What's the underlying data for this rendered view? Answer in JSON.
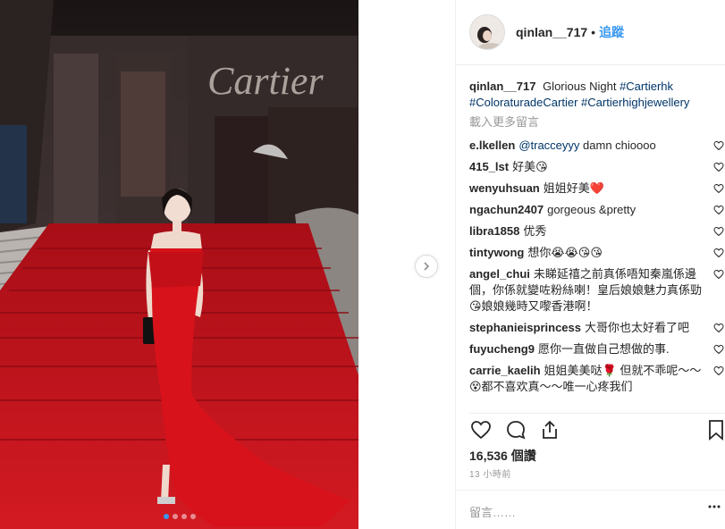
{
  "photo": {
    "sign_text": "Cartier",
    "carousel_total": 4,
    "carousel_active": 1
  },
  "header": {
    "username": "qinlan__717",
    "separator": "•",
    "follow_label": "追蹤"
  },
  "caption": {
    "username": "qinlan__717",
    "text": "Glorious Night",
    "tags": [
      "#Cartierhk",
      "#ColoraturadeCartier",
      "#Cartierhighjewellery"
    ]
  },
  "load_more_label": "載入更多留言",
  "comments": [
    {
      "user": "e.lkellen",
      "mention": "@tracceyyy",
      "text": "damn chioooo"
    },
    {
      "user": "415_lst",
      "text": "好美😘"
    },
    {
      "user": "wenyuhsuan",
      "text": "姐姐好美❤️"
    },
    {
      "user": "ngachun2407",
      "text": "gorgeous &pretty"
    },
    {
      "user": "libra1858",
      "text": "优秀"
    },
    {
      "user": "tintywong",
      "text": "想你😭😭😘😘"
    },
    {
      "user": "angel_chui",
      "text": "未睇延禧之前真係唔知秦嵐係邊個，你係就變咗粉絲喇！皇后娘娘魅力真係勁😘娘娘幾時又嚟香港啊！"
    },
    {
      "user": "stephanieisprincess",
      "text": "大哥你也太好看了吧"
    },
    {
      "user": "fuyucheng9",
      "text": "愿你一直做自己想做的事."
    },
    {
      "user": "carrie_kaelih",
      "text": "姐姐美美哒🌹 但就不乖呢～～😵都不喜欢真～～唯一心疼我们"
    }
  ],
  "likes_count": "16,536",
  "likes_unit": "個讚",
  "timestamp": "13 小時前",
  "add_comment_placeholder": "留言……",
  "colors": {
    "link": "#003569",
    "follow": "#3897f0",
    "dress": "#d8121b",
    "carpet": "#c3141c"
  }
}
